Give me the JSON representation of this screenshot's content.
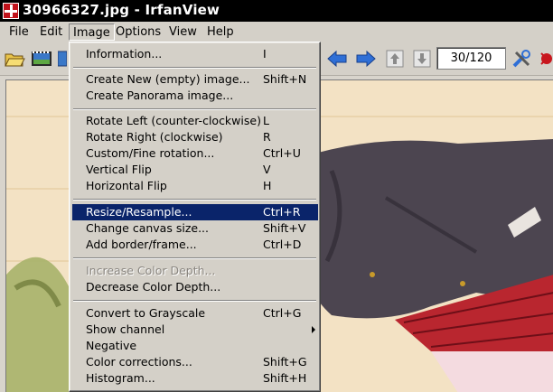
{
  "window": {
    "title": "30966327.jpg - IrfanView"
  },
  "menubar": {
    "items": [
      "File",
      "Edit",
      "Image",
      "Options",
      "View",
      "Help"
    ],
    "open": "Image"
  },
  "toolbar": {
    "buttons": [
      "open-icon",
      "slideshow-icon",
      "thumbnails-icon",
      "previous-icon",
      "next-icon",
      "first-page-icon",
      "last-page-icon",
      "properties-icon",
      "exit-icon"
    ],
    "page_indicator": "30/120"
  },
  "image_menu": {
    "items": [
      {
        "label": "Information...",
        "shortcut": "I"
      },
      {
        "label": "Create New (empty) image...",
        "shortcut": "Shift+N"
      },
      {
        "label": "Create Panorama image...",
        "shortcut": ""
      },
      {
        "label": "Rotate Left (counter-clockwise)",
        "shortcut": "L"
      },
      {
        "label": "Rotate Right (clockwise)",
        "shortcut": "R"
      },
      {
        "label": "Custom/Fine rotation...",
        "shortcut": "Ctrl+U"
      },
      {
        "label": "Vertical Flip",
        "shortcut": "V"
      },
      {
        "label": "Horizontal Flip",
        "shortcut": "H"
      },
      {
        "label": "Resize/Resample...",
        "shortcut": "Ctrl+R",
        "highlighted": true
      },
      {
        "label": "Change canvas size...",
        "shortcut": "Shift+V"
      },
      {
        "label": "Add border/frame...",
        "shortcut": "Ctrl+D"
      },
      {
        "label": "Increase Color Depth...",
        "shortcut": "",
        "disabled": true
      },
      {
        "label": "Decrease Color Depth...",
        "shortcut": ""
      },
      {
        "label": "Convert to Grayscale",
        "shortcut": "Ctrl+G"
      },
      {
        "label": "Show channel",
        "shortcut": "",
        "submenu": true
      },
      {
        "label": "Negative",
        "shortcut": ""
      },
      {
        "label": "Color corrections...",
        "shortcut": "Shift+G"
      },
      {
        "label": "Histogram...",
        "shortcut": "Shift+H"
      }
    ]
  },
  "colors": {
    "titlebar": "#000000",
    "menu_highlight": "#0a246a",
    "chrome": "#d4d0c8",
    "arrow_blue": "#2f6fd6"
  }
}
